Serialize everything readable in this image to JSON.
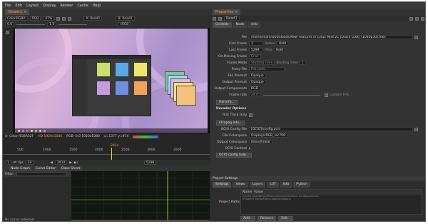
{
  "menu": [
    "File",
    "Edit",
    "Layout",
    "Display",
    "Render",
    "Cache",
    "Help"
  ],
  "viewer_tab": "Viewer1",
  "properties_tab": "Properties",
  "viewer_controls": {
    "channel": "Color.RGBA",
    "colorspace": "RGB",
    "zoom": "47%",
    "gain": "0.0",
    "gamma": "1.0",
    "lut": "sRGB",
    "input_a": "A: Read1",
    "input_b": "B: Read1"
  },
  "viewer_info": {
    "colorspace": "A: Color RGBA32F",
    "format": "HD 1920x1080",
    "rgb": "RGB: 0.0 1920x1080",
    "extra": "x=1377 y=974"
  },
  "timeline": {
    "ticks": [
      "500",
      "1000",
      "1500",
      "2000",
      "2500",
      "3000",
      "3500"
    ],
    "fps": "fps",
    "fps_value": "24",
    "current_frame": "2914",
    "end_frame": "5299",
    "marker": "2914"
  },
  "bottom_tabs": [
    "Node Graph",
    "Curve Editor",
    "Dope Sheet"
  ],
  "filter_label": "Filter:",
  "curve_status": "No curve selected",
  "properties": {
    "node_name": "Read1",
    "tabs": [
      "Controls",
      "Node",
      "Info"
    ],
    "file_label": "File",
    "file_value": "/home/team/Downloads/New Features in Linux Mint 21 [Quick Look] (1080p30).mkv",
    "first_frame_label": "First Frame",
    "first_frame": "1",
    "before_label": "Before",
    "before_value": "Hold",
    "last_frame_label": "Last Frame",
    "last_frame": "5299",
    "after_label": "After",
    "after_value": "Hold",
    "on_missing_label": "On Missing Frame",
    "on_missing": "Error",
    "frame_mode_label": "Frame Mode",
    "frame_mode": "Starting Time",
    "starting_time_label": "Starting Time",
    "starting_time": "1",
    "proxy_label": "Proxy File",
    "proxy_placeholder": "File path...",
    "file_premult_label": "File Premult",
    "file_premult": "Opaque",
    "output_premult_label": "Output Premult",
    "output_premult": "Opaque",
    "output_components_label": "Output Components",
    "output_components": "RGB",
    "frame_rate_label": "Frame rate",
    "frame_rate": "24.0",
    "custom_fps_label": "Custom FPS",
    "file_info_button": "File Info...",
    "decoder_options": "Decoder Options",
    "first_track_label": "First Track Only",
    "ffmpeg_info_button": "FFmpeg Info...",
    "ocio_config_label": "OCIO Config File",
    "ocio_config": "[OCIO]/config.ocio",
    "file_colorspace_label": "File Colorspace",
    "file_colorspace": "Display/sRGB_rec709",
    "output_colorspace_label": "Output Colorspace",
    "output_colorspace": "linear/linear",
    "ocio_context_label": "OCIO Context",
    "ocio_help_button": "OCIO config help..."
  },
  "project": {
    "title": "Project Settings",
    "tabs": [
      "Settings",
      "Views",
      "Layers",
      "LUT",
      "Info",
      "Python"
    ],
    "col_name": "Name",
    "col_value": "Value",
    "paths_label": "Project Paths",
    "path_rows": [
      "[OCIO] /opt/Natron/Resources/OpenColorIO-Configs/blender",
      "[Plugins] /home/team/.Natron/plugins"
    ],
    "add_button": "Add...",
    "remove_button": "Remove",
    "edit_button": "Edit..."
  },
  "colors": {
    "accent": "#f0a040",
    "curve_grid": "#1e3a1e",
    "playhead": "#d8e04a"
  }
}
